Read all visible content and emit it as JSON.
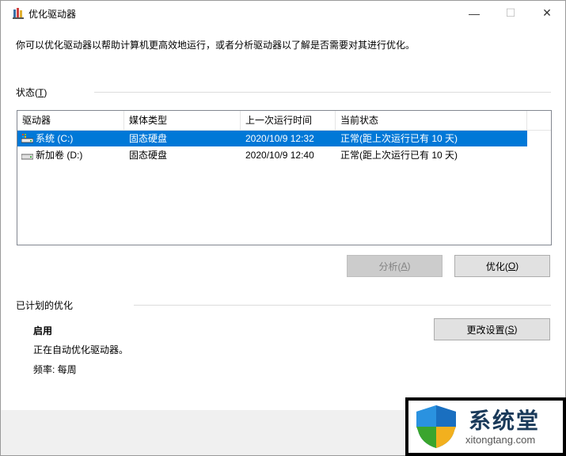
{
  "window": {
    "title": "优化驱动器",
    "minimize_glyph": "—",
    "maximize_glyph": "☐",
    "close_glyph": "✕"
  },
  "description": "你可以优化驱动器以帮助计算机更高效地运行，或者分析驱动器以了解是否需要对其进行优化。",
  "status": {
    "label_prefix": "状态(",
    "label_key": "T",
    "label_suffix": ")"
  },
  "drives": {
    "columns": [
      "驱动器",
      "媒体类型",
      "上一次运行时间",
      "当前状态"
    ],
    "rows": [
      {
        "name": "系统 (C:)",
        "media": "固态硬盘",
        "last_run": "2020/10/9 12:32",
        "status": "正常(距上次运行已有 10 天)",
        "icon": "system-drive-icon",
        "selected": true
      },
      {
        "name": "新加卷 (D:)",
        "media": "固态硬盘",
        "last_run": "2020/10/9 12:40",
        "status": "正常(距上次运行已有 10 天)",
        "icon": "drive-icon",
        "selected": false
      }
    ]
  },
  "actions": {
    "analyze_prefix": "分析(",
    "analyze_key": "A",
    "analyze_suffix": ")",
    "optimize_prefix": "优化(",
    "optimize_key": "O",
    "optimize_suffix": ")"
  },
  "schedule": {
    "header": "已计划的优化",
    "state": "启用",
    "detail": "正在自动优化驱动器。",
    "frequency": "频率: 每周",
    "change_prefix": "更改设置(",
    "change_key": "S",
    "change_suffix": ")"
  },
  "watermark": {
    "title": "系统堂",
    "url": "xitongtang.com"
  },
  "colors": {
    "selection": "#0078d7",
    "footer": "#f0f0f0",
    "button": "#e1e1e1",
    "button_disabled": "#cccccc"
  }
}
